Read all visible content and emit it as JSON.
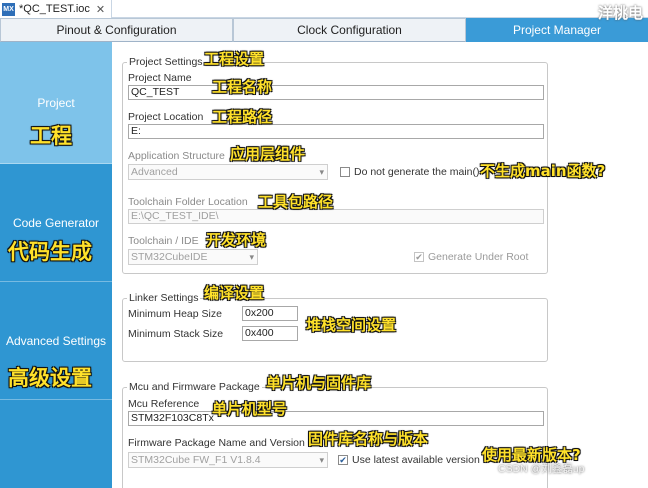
{
  "file_tab": {
    "icon": "MX",
    "name": "*QC_TEST.ioc",
    "close": "✕"
  },
  "tabs": [
    {
      "label": "Pinout & Configuration"
    },
    {
      "label": "Clock Configuration"
    },
    {
      "label": "Project Manager"
    }
  ],
  "sidebar": {
    "items": [
      {
        "label": "Project",
        "annotation": "工程"
      },
      {
        "label": "Code Generator",
        "annotation": "代码生成"
      },
      {
        "label": "Advanced Settings",
        "annotation": "高级设置"
      }
    ]
  },
  "project_settings": {
    "legend": "Project Settings",
    "legend_annotation": "工程设置",
    "project_name_label": "Project Name",
    "project_name_annotation": "工程名称",
    "project_name_value": "QC_TEST",
    "project_location_label": "Project Location",
    "project_location_annotation": "工程路径",
    "project_location_value": "E:",
    "app_structure_label": "Application Structure",
    "app_structure_annotation": "应用层组件",
    "app_structure_value": "Advanced",
    "no_main_label": "Do not generate the main()",
    "no_main_annotation": "不生成main函数?",
    "toolchain_folder_label": "Toolchain Folder Location",
    "toolchain_folder_annotation": "工具包路径",
    "toolchain_folder_value": "E:\\QC_TEST_IDE\\",
    "toolchain_ide_label": "Toolchain / IDE",
    "toolchain_ide_annotation": "开发环境",
    "toolchain_ide_value": "STM32CubeIDE",
    "generate_under_root_label": "Generate Under Root"
  },
  "linker_settings": {
    "legend": "Linker Settings",
    "legend_annotation": "编译设置",
    "heap_label": "Minimum Heap Size",
    "heap_value": "0x200",
    "stack_label": "Minimum Stack Size",
    "stack_value": "0x400",
    "annotation": "堆栈空间设置"
  },
  "mcu_firmware": {
    "legend": "Mcu and Firmware Package",
    "legend_annotation": "单片机与固件库",
    "mcu_ref_label": "Mcu Reference",
    "mcu_ref_annotation": "单片机型号",
    "mcu_ref_value": "STM32F103C8Tx",
    "fw_label": "Firmware Package Name and Version",
    "fw_annotation": "固件库名称与版本",
    "fw_value": "STM32Cube FW_F1 V1.8.4",
    "use_latest_label": "Use latest available version",
    "use_latest_annotation": "使用最新版本?"
  },
  "watermarks": {
    "top_right": "洋桃电",
    "bottom_right": "CSDN @刘鑫磊up"
  },
  "colors": {
    "accent": "#2f96d2",
    "active_nav": "#7ec3ea",
    "annotation": "#ffe12a"
  }
}
